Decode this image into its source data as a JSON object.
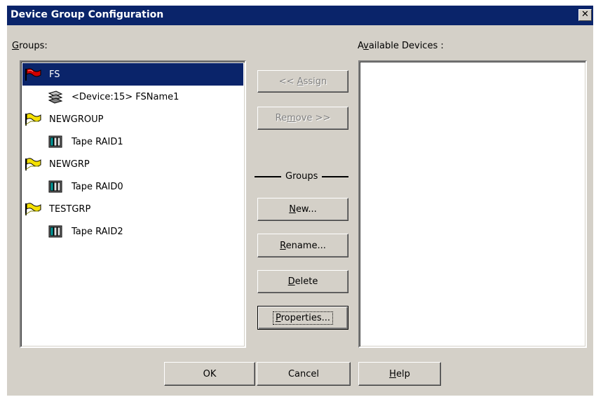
{
  "window": {
    "title": "Device Group Configuration",
    "close": "✕"
  },
  "groups": {
    "label": "Groups:",
    "tree": [
      {
        "text": "FS",
        "icon": "red-flag-icon",
        "level": 0,
        "selected": true
      },
      {
        "text": "<Device:15> FSName1",
        "icon": "network-device-icon",
        "level": 1
      },
      {
        "text": "NEWGROUP",
        "icon": "yellow-flag-icon",
        "level": 0
      },
      {
        "text": "Tape RAID1",
        "icon": "tape-raid-icon",
        "level": 1
      },
      {
        "text": "NEWGRP",
        "icon": "yellow-flag-icon",
        "level": 0
      },
      {
        "text": "Tape RAID0",
        "icon": "tape-raid-icon",
        "level": 1
      },
      {
        "text": "TESTGRP",
        "icon": "yellow-flag-icon",
        "level": 0
      },
      {
        "text": "Tape RAID2",
        "icon": "tape-raid-icon",
        "level": 1
      }
    ]
  },
  "available": {
    "label": "Available Devices :"
  },
  "buttons": {
    "assign": "<< Assign",
    "remove": "Remove >>",
    "groups_separator": "Groups",
    "new": "New...",
    "rename": "Rename...",
    "delete": "Delete",
    "properties": "Properties...",
    "ok": "OK",
    "cancel": "Cancel",
    "help": "Help"
  },
  "colors": {
    "title_bar": "#0a246a",
    "dialog_bg": "#d4d0c8",
    "selection": "#0a246a",
    "disabled_text": "#808080"
  }
}
